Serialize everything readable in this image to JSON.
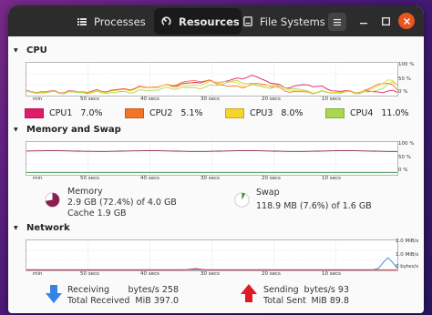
{
  "tabs": [
    {
      "label": "Processes",
      "icon": "list-icon"
    },
    {
      "label": "Resources",
      "icon": "gauge-icon",
      "active": true
    },
    {
      "label": "File Systems",
      "icon": "drive-icon"
    }
  ],
  "cpu": {
    "title": "CPU",
    "y_labels": [
      "100 %",
      "50 %",
      "0 %"
    ],
    "x_labels": [
      "min",
      "50 secs",
      "40 secs",
      "30 secs",
      "20 secs",
      "10 secs"
    ],
    "legend": [
      {
        "name": "CPU1",
        "value": "7.0%",
        "color": "#e01b6a"
      },
      {
        "name": "CPU2",
        "value": "5.1%",
        "color": "#f37329"
      },
      {
        "name": "CPU3",
        "value": "8.0%",
        "color": "#f6d32d"
      },
      {
        "name": "CPU4",
        "value": "11.0%",
        "color": "#a8d84d"
      }
    ]
  },
  "memory": {
    "title": "Memory and Swap",
    "y_labels": [
      "100 %",
      "50 %",
      "0 %"
    ],
    "x_labels": [
      "min",
      "50 secs",
      "40 secs",
      "30 secs",
      "20 secs",
      "10 secs"
    ],
    "mem_label": "Memory",
    "mem_usage": "2.9 GB (72.4%) of 4.0 GB",
    "mem_cache": "Cache 1.9 GB",
    "mem_fraction": 0.724,
    "mem_color": "#8a2050",
    "swap_label": "Swap",
    "swap_usage": "118.9 MB (7.6%) of 1.6 GB",
    "swap_fraction": 0.076,
    "swap_color": "#2e8b3e"
  },
  "network": {
    "title": "Network",
    "y_labels": [
      "2.0 MiB/s",
      "1.0 MiB/s",
      "0 bytes/s"
    ],
    "x_labels": [
      "min",
      "50 secs",
      "40 secs",
      "30 secs",
      "20 secs",
      "10 secs"
    ],
    "receiving_label": "Receiving",
    "receiving_value": "258 bytes/s",
    "total_received_label": "Total Received",
    "total_received_value": "397.0 MiB",
    "sending_label": "Sending",
    "sending_value": "93 bytes/s",
    "total_sent_label": "Total Sent",
    "total_sent_value": "89.8 MiB",
    "receive_color": "#3584e4",
    "send_color": "#e01b24"
  }
}
